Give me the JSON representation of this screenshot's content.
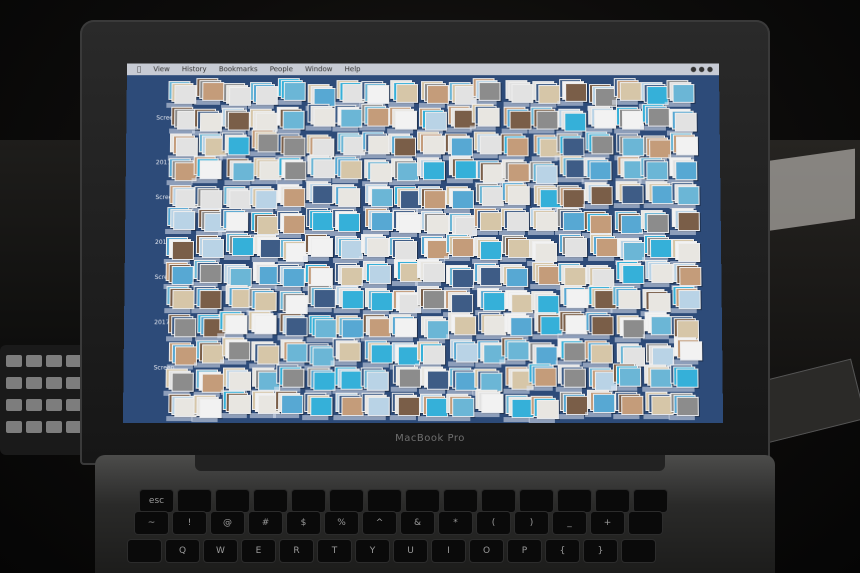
{
  "menubar": {
    "items": [
      "View",
      "History",
      "Bookmarks",
      "People",
      "Window",
      "Help"
    ]
  },
  "desktop": {
    "left_labels": [
      "Screen",
      "2017",
      "Screen",
      "2017",
      "Screen",
      "2017",
      "Screen"
    ],
    "thumb_colors": [
      "#e8e6e1",
      "#6bb6d6",
      "#d6c6a8",
      "#3e5c86",
      "#c49c7a",
      "#e2e2e2",
      "#57a8d3",
      "#8c8c8c",
      "#b9d3e6",
      "#f2f2f2",
      "#7a5e48",
      "#35b0d9"
    ]
  },
  "laptop": {
    "bezel_name": "MacBook Pro"
  },
  "keyboard": {
    "row1": [
      "esc",
      "",
      "",
      "",
      "",
      "",
      "",
      "",
      "",
      "",
      "",
      "",
      "",
      ""
    ],
    "row2": [
      "~",
      "!",
      "@",
      "#",
      "$",
      "%",
      "^",
      "&",
      "*",
      "(",
      ")",
      "_",
      "+",
      ""
    ],
    "row3": [
      "",
      "Q",
      "W",
      "E",
      "R",
      "T",
      "Y",
      "U",
      "I",
      "O",
      "P",
      "{",
      "}",
      ""
    ]
  }
}
